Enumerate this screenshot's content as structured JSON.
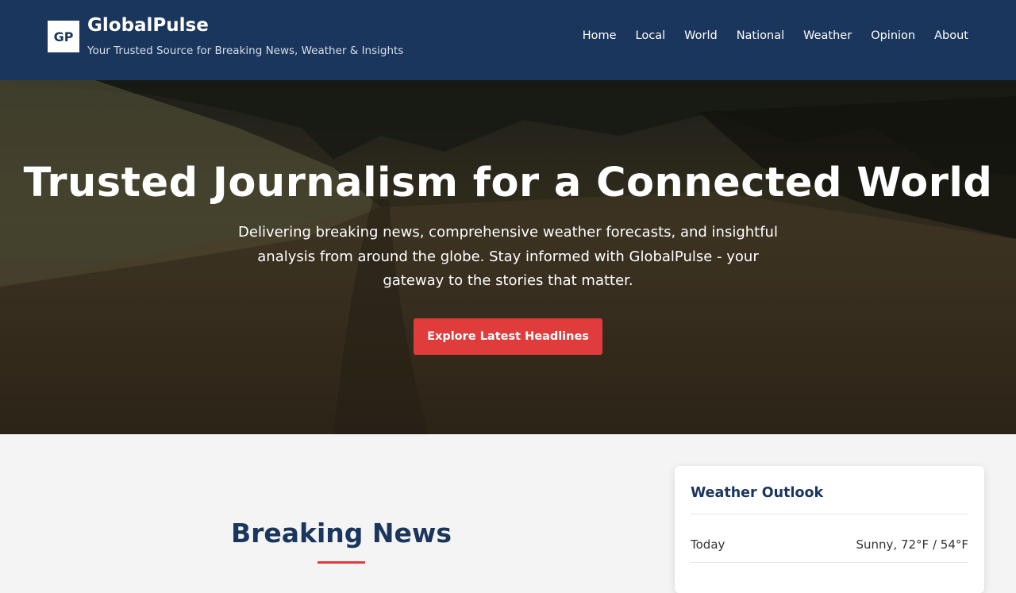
{
  "header": {
    "logo_text": "GP",
    "brand_name": "GlobalPulse",
    "tagline": "Your Trusted Source for Breaking News, Weather & Insights",
    "nav": [
      "Home",
      "Local",
      "World",
      "National",
      "Weather",
      "Opinion",
      "About"
    ],
    "background_color": "#1b365d"
  },
  "hero": {
    "title": "Trusted Journalism for a Connected World",
    "description": "Delivering breaking news, comprehensive weather forecasts, and insightful analysis from around the globe. Stay informed with GlobalPulse - your gateway to the stories that matter.",
    "cta_label": "Explore Latest Headlines",
    "cta_color": "#e03c3c"
  },
  "main": {
    "section_title": "Breaking News"
  },
  "weather": {
    "title": "Weather Outlook",
    "rows": [
      {
        "day": "Today",
        "forecast": "Sunny, 72°F / 54°F"
      }
    ]
  }
}
